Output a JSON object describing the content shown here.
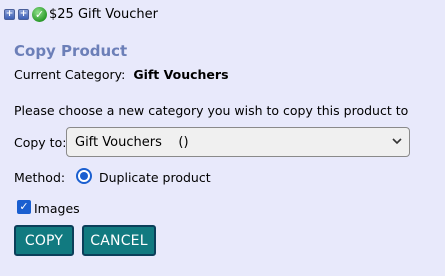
{
  "product": {
    "name": "$25 Gift Voucher"
  },
  "panel": {
    "title": "Copy Product",
    "current_category_label": "Current Category:",
    "current_category_value": "Gift Vouchers",
    "instructions": "Please choose a new category you wish to copy this product to",
    "copy_to_label": "Copy to:",
    "copy_to_selected": "Gift Vouchers    ()",
    "method_label": "Method:",
    "method_option": "Duplicate product",
    "images_label": "Images"
  },
  "buttons": {
    "copy": "COPY",
    "cancel": "CANCEL"
  },
  "icons": {
    "expand_1": "plus-icon",
    "expand_2": "plus-icon",
    "status": "check-icon",
    "dropdown": "chevron-down-icon"
  },
  "colors": {
    "background": "#e8e9fb",
    "title": "#6c7fb8",
    "button": "#117a80",
    "accent": "#1a5fd0"
  }
}
